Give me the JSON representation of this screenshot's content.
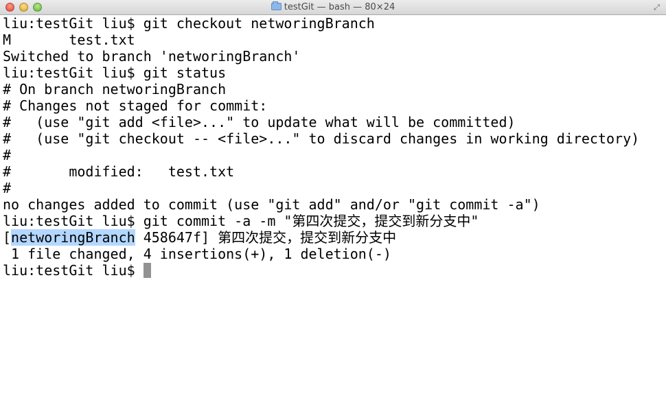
{
  "window": {
    "title": "testGit — bash — 80×24"
  },
  "terminal": {
    "lines": [
      "liu:testGit liu$ git checkout networingBranch",
      "M       test.txt",
      "Switched to branch 'networingBranch'",
      "liu:testGit liu$ git status",
      "# On branch networingBranch",
      "# Changes not staged for commit:",
      "#   (use \"git add <file>...\" to update what will be committed)",
      "#   (use \"git checkout -- <file>...\" to discard changes in working directory)",
      "#",
      "#       modified:   test.txt",
      "#",
      "no changes added to commit (use \"git add\" and/or \"git commit -a\")",
      "liu:testGit liu$ git commit -a -m \"第四次提交，提交到新分支中\""
    ],
    "commit_open_bracket": "[",
    "commit_branch": "networingBranch",
    "commit_rest": " 458647f] 第四次提交，提交到新分支中",
    "stats_line": " 1 file changed, 4 insertions(+), 1 deletion(-)",
    "prompt": "liu:testGit liu$ "
  },
  "icons": {
    "close": "close-icon",
    "minimize": "minimize-icon",
    "zoom": "zoom-icon",
    "folder": "folder-icon",
    "fullscreen": "fullscreen-icon"
  },
  "colors": {
    "selection": "#b3d7ff",
    "cursor": "#929292",
    "close": "#e0443a",
    "minimize": "#dba12b",
    "zoom": "#5fb33a"
  }
}
